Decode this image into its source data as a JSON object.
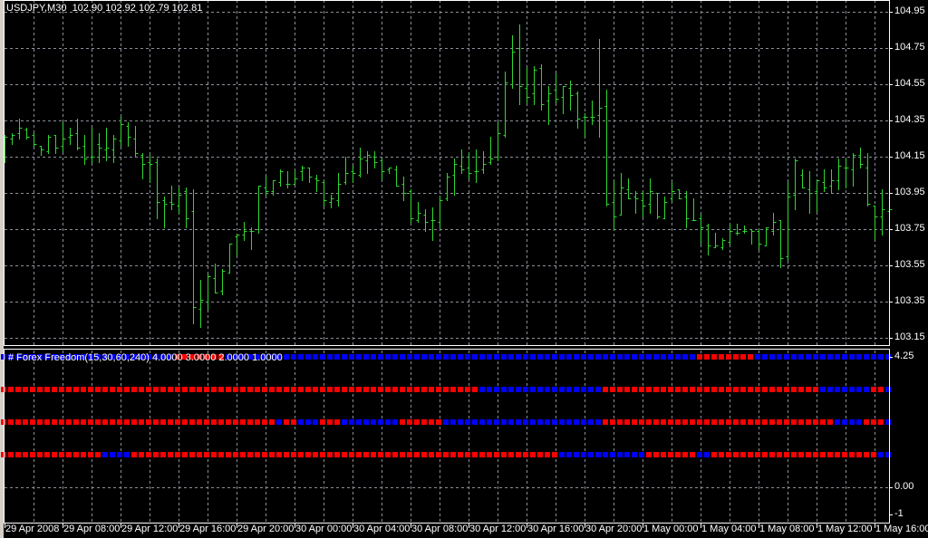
{
  "window": {
    "title": "USDJPY,M30",
    "ohlc_readout": "102.90 102.92 102.79 102.81"
  },
  "colors": {
    "background": "#000000",
    "bars": "#2fd62f",
    "grid": "#8a8f99",
    "axis": "#ffffff",
    "indicator_up": "#0000ff",
    "indicator_down": "#ff0000"
  },
  "price_axis": {
    "labels": [
      "104.95",
      "104.75",
      "104.55",
      "104.35",
      "104.15",
      "103.95",
      "103.75",
      "103.55",
      "103.35",
      "103.15"
    ]
  },
  "indicator": {
    "label": "# Forex Freedom(15,30,60,240) 4.0000 3.0000 2.0000 1.0000",
    "axis_labels": [
      "4.25",
      "0.00",
      "-1"
    ],
    "rows": [
      {
        "value": 4,
        "segments": [
          [
            "blue",
            0,
            23
          ],
          [
            "red",
            24,
            30
          ],
          [
            "blue",
            31,
            95
          ],
          [
            "red",
            96,
            103
          ],
          [
            "blue",
            104,
            122
          ]
        ]
      },
      {
        "value": 3,
        "segments": [
          [
            "red",
            0,
            65
          ],
          [
            "blue",
            66,
            82
          ],
          [
            "red",
            83,
            112
          ],
          [
            "blue",
            113,
            119
          ],
          [
            "red",
            120,
            121
          ],
          [
            "blue",
            122,
            122
          ]
        ]
      },
      {
        "value": 2,
        "segments": [
          [
            "red",
            0,
            37
          ],
          [
            "blue",
            38,
            38
          ],
          [
            "red",
            39,
            40
          ],
          [
            "blue",
            41,
            43
          ],
          [
            "red",
            44,
            46
          ],
          [
            "blue",
            47,
            54
          ],
          [
            "red",
            55,
            60
          ],
          [
            "blue",
            61,
            82
          ],
          [
            "red",
            83,
            114
          ],
          [
            "blue",
            115,
            118
          ],
          [
            "red",
            119,
            121
          ],
          [
            "blue",
            122,
            122
          ]
        ]
      },
      {
        "value": 1,
        "segments": [
          [
            "red",
            0,
            13
          ],
          [
            "blue",
            14,
            17
          ],
          [
            "red",
            18,
            76
          ],
          [
            "blue",
            77,
            88
          ],
          [
            "red",
            89,
            95
          ],
          [
            "blue",
            96,
            97
          ],
          [
            "red",
            98,
            120
          ],
          [
            "blue",
            121,
            122
          ]
        ]
      }
    ]
  },
  "time_axis": {
    "labels": [
      "29 Apr 2008",
      "29 Apr 08:00",
      "29 Apr 12:00",
      "29 Apr 16:00",
      "29 Apr 20:00",
      "30 Apr 00:00",
      "30 Apr 04:00",
      "30 Apr 08:00",
      "30 Apr 12:00",
      "30 Apr 16:00",
      "30 Apr 20:00",
      "1 May 00:00",
      "1 May 04:00",
      "1 May 08:00",
      "1 May 12:00",
      "1 May 16:00"
    ]
  },
  "chart_data": {
    "type": "ohlc",
    "symbol": "USDJPY",
    "timeframe": "M30",
    "ylim": [
      103.15,
      104.95
    ],
    "grid": true,
    "bars": [
      [
        104.27,
        104.27,
        104.12,
        104.26
      ],
      [
        104.25,
        104.28,
        104.22,
        104.27
      ],
      [
        104.28,
        104.36,
        104.25,
        104.31
      ],
      [
        104.3,
        104.31,
        104.25,
        104.26
      ],
      [
        104.27,
        104.28,
        104.21,
        104.22
      ],
      [
        104.21,
        104.21,
        104.16,
        104.19
      ],
      [
        104.18,
        104.27,
        104.17,
        104.26
      ],
      [
        104.27,
        104.27,
        104.17,
        104.2
      ],
      [
        104.21,
        104.34,
        104.18,
        104.25
      ],
      [
        104.26,
        104.31,
        104.22,
        104.27
      ],
      [
        104.28,
        104.36,
        104.19,
        104.2
      ],
      [
        104.21,
        104.27,
        104.11,
        104.14
      ],
      [
        104.15,
        104.31,
        104.12,
        104.15
      ],
      [
        104.22,
        104.28,
        104.12,
        104.2
      ],
      [
        104.19,
        104.31,
        104.13,
        104.2
      ],
      [
        104.19,
        104.27,
        104.12,
        104.25
      ],
      [
        104.24,
        104.37,
        104.21,
        104.33
      ],
      [
        104.32,
        104.34,
        104.21,
        104.26
      ],
      [
        104.25,
        104.32,
        104.15,
        104.17
      ],
      [
        104.16,
        104.17,
        104.03,
        104.11
      ],
      [
        104.12,
        104.16,
        104.01,
        104.11
      ],
      [
        104.12,
        104.14,
        103.81,
        103.9
      ],
      [
        103.91,
        103.93,
        103.76,
        103.89
      ],
      [
        103.9,
        103.99,
        103.86,
        103.89
      ],
      [
        103.88,
        103.98,
        103.84,
        103.94
      ],
      [
        103.96,
        103.98,
        103.76,
        103.81
      ],
      [
        103.85,
        103.97,
        103.23,
        103.32
      ],
      [
        103.31,
        103.47,
        103.21,
        103.36
      ],
      [
        103.35,
        103.5,
        103.31,
        103.49
      ],
      [
        103.48,
        103.56,
        103.4,
        103.4
      ],
      [
        103.41,
        103.53,
        103.39,
        103.52
      ],
      [
        103.51,
        103.67,
        103.51,
        103.67
      ],
      [
        103.71,
        103.72,
        103.61,
        103.72
      ],
      [
        103.72,
        103.79,
        103.69,
        103.74
      ],
      [
        103.74,
        103.76,
        103.64,
        103.74
      ],
      [
        103.75,
        103.99,
        103.73,
        103.99
      ],
      [
        103.98,
        104.04,
        103.94,
        103.96
      ],
      [
        103.96,
        104.02,
        103.94,
        104.02
      ],
      [
        104.01,
        104.08,
        103.99,
        104.07
      ],
      [
        104.0,
        104.07,
        103.98,
        104.0
      ],
      [
        104.0,
        104.07,
        104.0,
        104.03
      ],
      [
        104.07,
        104.1,
        104.02,
        104.09
      ],
      [
        104.09,
        104.09,
        104.01,
        104.04
      ],
      [
        104.03,
        104.05,
        103.96,
        104.02
      ],
      [
        104.01,
        104.02,
        103.88,
        103.91
      ],
      [
        103.9,
        103.94,
        103.87,
        103.92
      ],
      [
        103.91,
        104.06,
        103.88,
        104.0
      ],
      [
        104.01,
        104.15,
        104.0,
        104.06
      ],
      [
        104.07,
        104.1,
        104.01,
        104.06
      ],
      [
        104.05,
        104.2,
        104.04,
        104.14
      ],
      [
        104.13,
        104.18,
        104.06,
        104.16
      ],
      [
        104.15,
        104.18,
        104.09,
        104.12
      ],
      [
        104.13,
        104.14,
        104.03,
        104.07
      ],
      [
        104.08,
        104.09,
        104.06,
        104.09
      ],
      [
        104.08,
        104.1,
        103.99,
        103.99
      ],
      [
        104.0,
        104.04,
        103.91,
        103.95
      ],
      [
        103.96,
        103.97,
        103.79,
        103.81
      ],
      [
        103.8,
        103.9,
        103.79,
        103.84
      ],
      [
        103.83,
        103.86,
        103.74,
        103.79
      ],
      [
        103.8,
        103.87,
        103.69,
        103.8
      ],
      [
        103.79,
        103.93,
        103.76,
        103.91
      ],
      [
        103.92,
        104.06,
        103.91,
        104.04
      ],
      [
        104.05,
        104.14,
        103.94,
        104.11
      ],
      [
        104.1,
        104.19,
        104.06,
        104.08
      ],
      [
        104.09,
        104.17,
        104.03,
        104.06
      ],
      [
        104.07,
        104.19,
        104.01,
        104.07
      ],
      [
        104.08,
        104.18,
        104.06,
        104.11
      ],
      [
        104.12,
        104.26,
        104.11,
        104.14
      ],
      [
        104.15,
        104.34,
        104.13,
        104.28
      ],
      [
        104.27,
        104.62,
        104.26,
        104.56
      ],
      [
        104.55,
        104.82,
        104.53,
        104.73
      ],
      [
        104.75,
        104.88,
        104.44,
        104.54
      ],
      [
        104.53,
        104.64,
        104.45,
        104.48
      ],
      [
        104.5,
        104.65,
        104.44,
        104.63
      ],
      [
        104.64,
        104.66,
        104.41,
        104.44
      ],
      [
        104.46,
        104.54,
        104.33,
        104.5
      ],
      [
        104.52,
        104.61,
        104.45,
        104.47
      ],
      [
        104.48,
        104.54,
        104.39,
        104.54
      ],
      [
        104.53,
        104.57,
        104.41,
        104.49
      ],
      [
        104.5,
        104.51,
        104.31,
        104.36
      ],
      [
        104.37,
        104.39,
        104.26,
        104.37
      ],
      [
        104.37,
        104.46,
        104.33,
        104.37
      ],
      [
        104.38,
        104.8,
        104.26,
        104.42
      ],
      [
        104.43,
        104.52,
        103.88,
        103.89
      ],
      [
        103.9,
        104.02,
        103.75,
        103.82
      ],
      [
        103.83,
        104.06,
        103.83,
        103.98
      ],
      [
        103.97,
        104.03,
        103.92,
        103.92
      ],
      [
        103.93,
        103.96,
        103.84,
        103.92
      ],
      [
        103.91,
        103.96,
        103.82,
        103.88
      ],
      [
        103.89,
        104.03,
        103.84,
        103.96
      ],
      [
        103.95,
        103.95,
        103.81,
        103.82
      ],
      [
        103.81,
        103.93,
        103.81,
        103.9
      ],
      [
        103.92,
        104.01,
        103.91,
        103.96
      ],
      [
        103.97,
        103.97,
        103.92,
        103.92
      ],
      [
        103.93,
        103.96,
        103.76,
        103.81
      ],
      [
        103.8,
        103.92,
        103.8,
        103.8
      ],
      [
        103.81,
        103.83,
        103.67,
        103.76
      ],
      [
        103.77,
        103.78,
        103.61,
        103.66
      ],
      [
        103.65,
        103.73,
        103.65,
        103.66
      ],
      [
        103.65,
        103.7,
        103.64,
        103.69
      ],
      [
        103.68,
        103.78,
        103.67,
        103.74
      ],
      [
        103.73,
        103.78,
        103.72,
        103.73
      ],
      [
        103.74,
        103.77,
        103.73,
        103.74
      ],
      [
        103.75,
        103.75,
        103.67,
        103.74
      ],
      [
        103.74,
        103.75,
        103.64,
        103.67
      ],
      [
        103.66,
        103.76,
        103.66,
        103.76
      ],
      [
        103.74,
        103.84,
        103.72,
        103.79
      ],
      [
        103.8,
        103.8,
        103.54,
        103.59
      ],
      [
        103.6,
        104.01,
        103.58,
        103.93
      ],
      [
        103.94,
        104.14,
        103.86,
        104.13
      ],
      [
        104.05,
        104.08,
        103.98,
        103.98
      ],
      [
        103.97,
        104.07,
        103.84,
        103.95
      ],
      [
        103.96,
        104.02,
        103.85,
        104.02
      ],
      [
        104.01,
        104.08,
        103.96,
        103.98
      ],
      [
        103.99,
        104.08,
        103.95,
        104.02
      ],
      [
        104.02,
        104.14,
        103.97,
        104.1
      ],
      [
        104.09,
        104.14,
        103.98,
        104.09
      ],
      [
        104.08,
        104.17,
        103.99,
        104.16
      ],
      [
        104.16,
        104.2,
        104.09,
        104.11
      ],
      [
        104.09,
        104.17,
        103.88,
        103.89
      ],
      [
        103.88,
        103.88,
        103.7,
        103.82
      ],
      [
        103.82,
        103.97,
        103.72,
        103.86
      ],
      [
        103.85,
        104.13,
        103.82,
        103.86
      ]
    ]
  }
}
